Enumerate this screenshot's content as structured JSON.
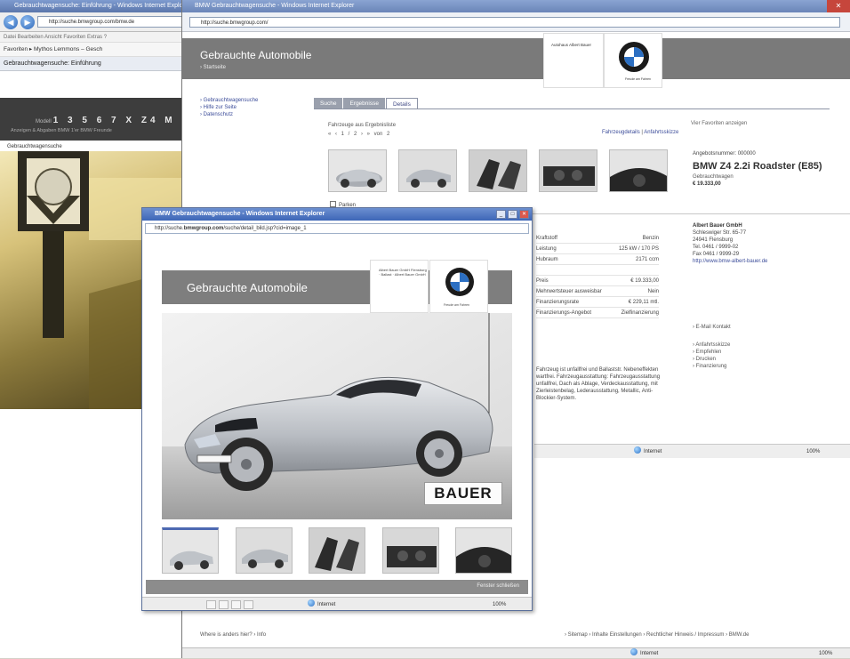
{
  "background_window": {
    "title": "Gebrauchtwagensuche: Einführung - Windows Internet Explorer",
    "address": "http://suche.bmwgroup.com/bmw.de",
    "menu": "Datei  Bearbeiten  Ansicht  Favoriten  Extras  ?",
    "favorites": "Favoriten   ▸ Mythos Lemmons – Gesch",
    "tab": "Gebrauchtwagensuche: Einführung",
    "models_prefix": "Modell",
    "models": "1 3 5 6 7 X Z4 M",
    "sub_line": "Anzeigen & Abgaben   BMW 1'er   BMW Freunde",
    "used_label": "Gebrauchtwagensuche"
  },
  "main_window": {
    "title": "BMW Gebrauchtwagensuche - Windows Internet Explorer",
    "address": "http://suche.bmwgroup.com/",
    "header": {
      "title": "Gebrauchte Automobile",
      "subtitle": "› Startseite"
    },
    "dealer_name_small": "Autohaus Albert Bauer",
    "logo_caption": "Freude am Fahren",
    "left_nav": [
      "› Gebrauchtwagensuche",
      "› Hilfe zur Seite",
      "› Datenschutz"
    ],
    "tabs": [
      "Suche",
      "Ergebnisse",
      "Details"
    ],
    "results_label": "Fahrzeuge aus Ergebnisliste",
    "pager": "« ‹ 1 / 2 › » von 2",
    "view_links": {
      "vehicle": "Fahrzeugdetails",
      "separator": "|",
      "dealer": "Anfahrtsskizze"
    },
    "favorites_link": "Vier Favoriten anzeigen",
    "park_label": "Parken",
    "offer": {
      "number": "Angebotsnummer: 000000",
      "name": "BMW Z4 2.2i Roadster (E85)",
      "condition": "Gebrauchtwagen",
      "price": "€ 19.333,00"
    },
    "specs": [
      {
        "k": "Kraftstoff",
        "v": "Benzin"
      },
      {
        "k": "Leistung",
        "v": "125 kW / 170 PS"
      },
      {
        "k": "Hubraum",
        "v": "2171 ccm"
      },
      {
        "k": "",
        "v": ""
      },
      {
        "k": "Preis",
        "v": "€ 19.333,00"
      },
      {
        "k": "Mehrwertsteuer ausweisbar",
        "v": "Nein"
      },
      {
        "k": "Finanzierungsrate",
        "v": "€ 229,11 mtl."
      },
      {
        "k": "Finanzierungs-Angebot",
        "v": "Zielfinanzierung"
      }
    ],
    "description": "Fahrzeug ist unfallfrei und Ballaststr. Nebeneffekten wartfrei. Fahrzeugausstattung: Fahrzeugausstattung unfallfrei, Dach als Ablage, Verdeckausstattung, mit Zierleistenbelag, Lederausstattung, Metallic, Anti-Blockier-System.",
    "dealer": {
      "name": "Albert Bauer GmbH",
      "street": "Schleswiger Str. 65-77",
      "city": "24941 Flensburg",
      "tel": "Tel. 0461 / 9999-02",
      "fax": "Fax 0461 / 9999-29",
      "web": "http://www.bmw-albert-bauer.de"
    },
    "contact_links": [
      "› E-Mail Kontakt",
      "› Anfahrtsskizze",
      "› Empfehlen",
      "› Drucken",
      "› Finanzierung"
    ],
    "mid_status": "Internet",
    "zoom": "100%",
    "footer_left": "Where is anders hier? › Info",
    "footer_right": "› Sitemap  › Inhalte Einstellungen  › Rechtlicher Hinweis / Impressum  › BMW.de",
    "status": "Internet"
  },
  "popup": {
    "title": "BMW Gebrauchtwagensuche - Windows Internet Explorer",
    "address_domain": "bmwgroup.com",
    "address_prefix": "http://suche.",
    "address_rest": "/suche/detail_bild.jsp?cid=image_1",
    "header_title": "Gebrauchte Automobile",
    "dealer_name": "Albert Bauer GmbH Flensburg · Ballast · Albert Bauer GmbH",
    "logo_caption": "Freude am Fahren",
    "plate_text": "BAUER",
    "footer_link": "Fenster schließen",
    "status": "Internet",
    "zoom": "100%"
  }
}
